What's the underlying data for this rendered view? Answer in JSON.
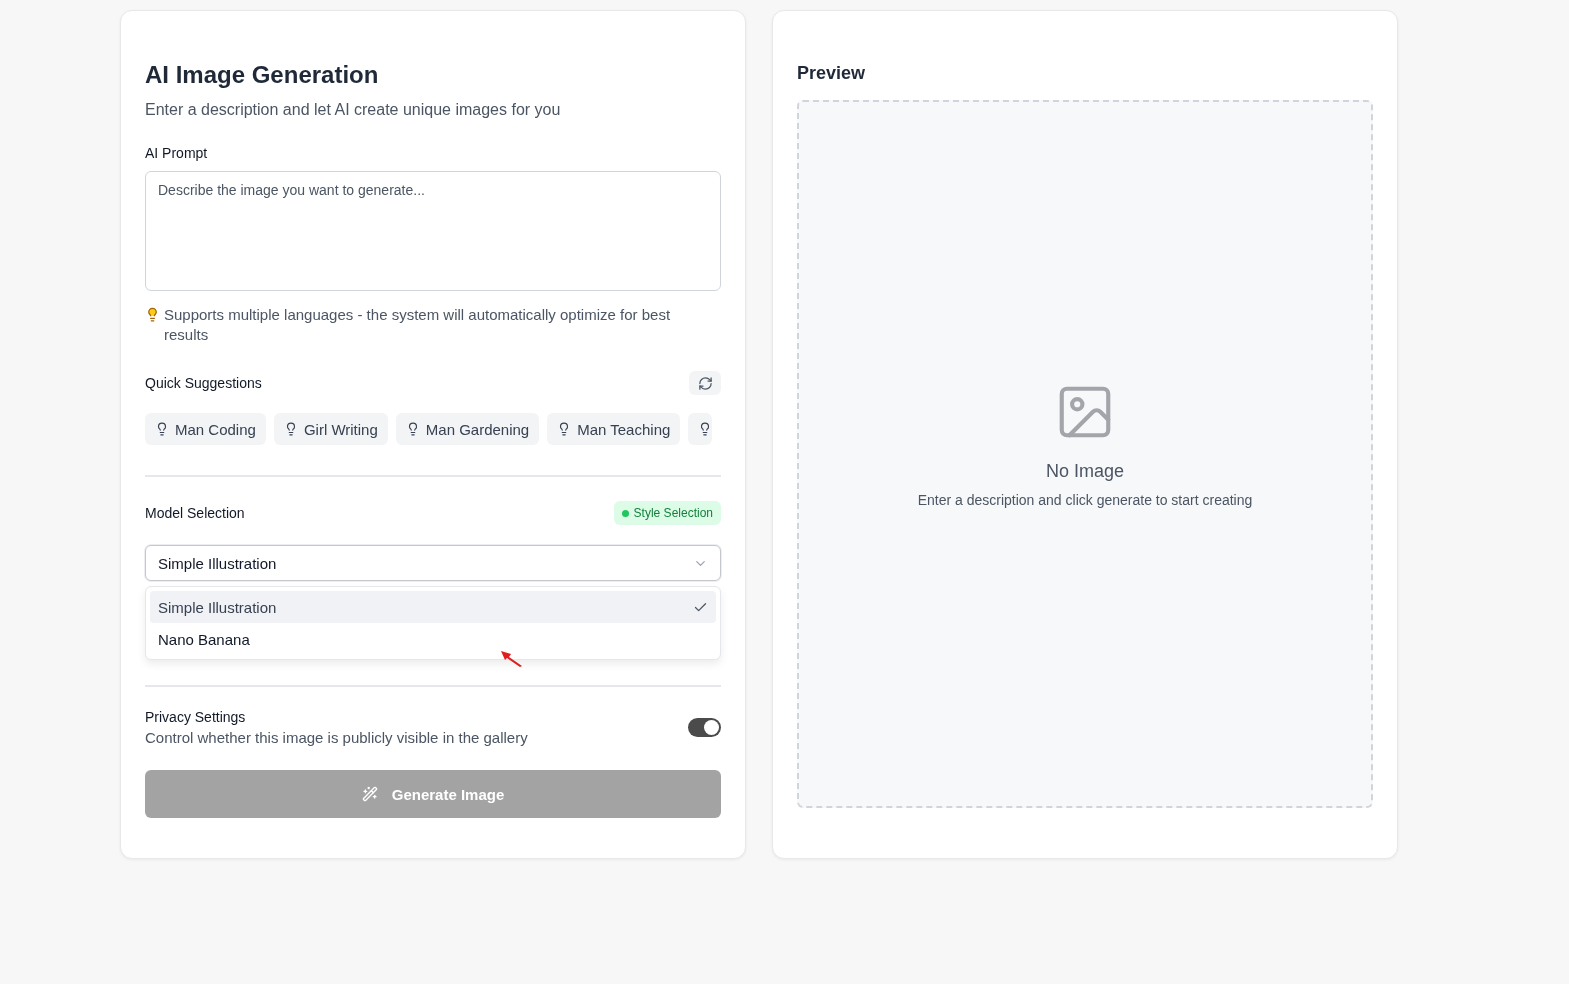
{
  "generator": {
    "title": "AI Image Generation",
    "subtitle": "Enter a description and let AI create unique images for you",
    "prompt": {
      "label": "AI Prompt",
      "placeholder": "Describe the image you want to generate..."
    },
    "hint": "Supports multiple languages - the system will automatically optimize for best results",
    "suggestions": {
      "title": "Quick Suggestions",
      "items": [
        {
          "kind": "chip",
          "label": "Man Coding"
        },
        {
          "kind": "chip",
          "label": "Girl Writing"
        },
        {
          "kind": "chip",
          "label": "Man Gardening"
        },
        {
          "kind": "chip",
          "label": "Man Teaching"
        },
        {
          "kind": "clipped"
        }
      ]
    },
    "model": {
      "label": "Model Selection",
      "badge": "Style Selection",
      "value": "Simple Illustration",
      "expanded": true,
      "options": [
        {
          "label": "Simple Illustration",
          "selected": true
        },
        {
          "label": "Nano Banana",
          "selected": false
        }
      ]
    },
    "privacy": {
      "title": "Privacy Settings",
      "description": "Control whether this image is publicly visible in the gallery",
      "on": true
    },
    "generate": {
      "label": "Generate Image",
      "disabled": true
    }
  },
  "preview": {
    "title": "Preview",
    "empty_title": "No Image",
    "empty_text": "Enter a description and click generate to start creating"
  }
}
